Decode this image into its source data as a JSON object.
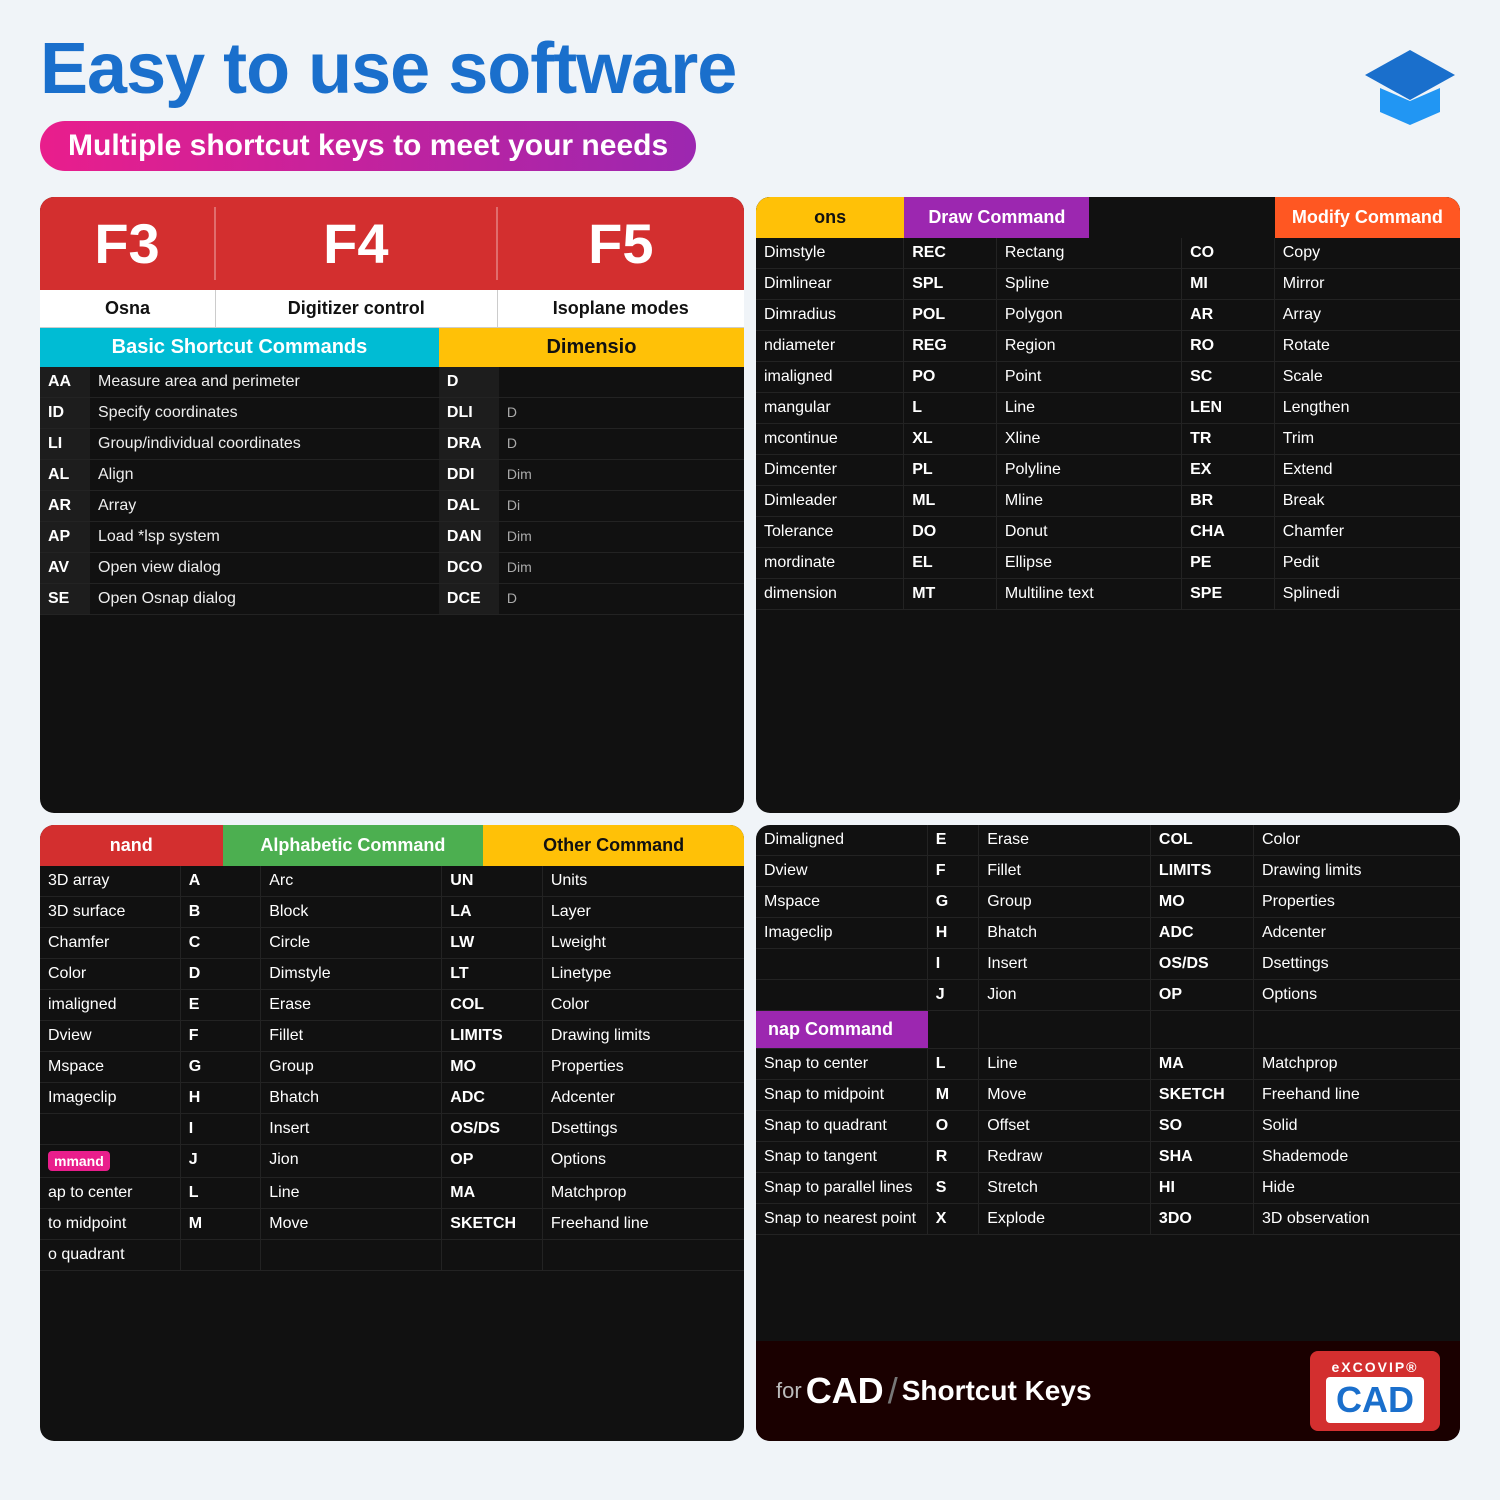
{
  "header": {
    "title": "Easy to use software",
    "subtitle": "Multiple shortcut keys to meet your needs"
  },
  "card1": {
    "fkeys": [
      {
        "key": "F3",
        "desc": "Osna"
      },
      {
        "key": "F4",
        "desc": "Digitizer control"
      },
      {
        "key": "F5",
        "desc": "Isoplane modes"
      }
    ],
    "basic_header": "Basic Shortcut Commands",
    "dim_header": "Dimensio",
    "basic_commands": [
      {
        "key": "AA",
        "desc": "Measure area and perimeter"
      },
      {
        "key": "ID",
        "desc": "Specify coordinates"
      },
      {
        "key": "LI",
        "desc": "Group/individual coordinates"
      },
      {
        "key": "AL",
        "desc": "Align"
      },
      {
        "key": "AR",
        "desc": "Array"
      },
      {
        "key": "AP",
        "desc": "Load *lsp system"
      },
      {
        "key": "AV",
        "desc": "Open view dialog"
      },
      {
        "key": "SE",
        "desc": "Open Osnap dialog"
      }
    ],
    "dim_commands": [
      {
        "key": "D",
        "desc": ""
      },
      {
        "key": "DLI",
        "desc": "D"
      },
      {
        "key": "DRA",
        "desc": "D"
      },
      {
        "key": "DDI",
        "desc": "Dim"
      },
      {
        "key": "DAL",
        "desc": "Di"
      },
      {
        "key": "DAN",
        "desc": "Dim"
      },
      {
        "key": "DCO",
        "desc": "Dim"
      },
      {
        "key": "DCE",
        "desc": "D"
      }
    ]
  },
  "card2": {
    "col_headers": [
      "ons",
      "Draw Command",
      "",
      "Modify Command"
    ],
    "rows": [
      {
        "c1": "Dimstyle",
        "c2": "REC",
        "c3": "Rectang",
        "c4": "CO",
        "c5": "Copy"
      },
      {
        "c1": "Dimlinear",
        "c2": "SPL",
        "c3": "Spline",
        "c4": "MI",
        "c5": "Mirror"
      },
      {
        "c1": "Dimradius",
        "c2": "POL",
        "c3": "Polygon",
        "c4": "AR",
        "c5": "Array"
      },
      {
        "c1": "ndiameter",
        "c2": "REG",
        "c3": "Region",
        "c4": "RO",
        "c5": "Rotate"
      },
      {
        "c1": "imaligned",
        "c2": "PO",
        "c3": "Point",
        "c4": "SC",
        "c5": "Scale"
      },
      {
        "c1": "mangular",
        "c2": "L",
        "c3": "Line",
        "c4": "LEN",
        "c5": "Lengthen"
      },
      {
        "c1": "mcontinue",
        "c2": "XL",
        "c3": "Xline",
        "c4": "TR",
        "c5": "Trim"
      },
      {
        "c1": "Dimcenter",
        "c2": "PL",
        "c3": "Polyline",
        "c4": "EX",
        "c5": "Extend"
      },
      {
        "c1": "Dimleader",
        "c2": "ML",
        "c3": "Mline",
        "c4": "BR",
        "c5": "Break"
      },
      {
        "c1": "Tolerance",
        "c2": "DO",
        "c3": "Donut",
        "c4": "CHA",
        "c5": "Chamfer"
      },
      {
        "c1": "mordinate",
        "c2": "EL",
        "c3": "Ellipse",
        "c4": "PE",
        "c5": "Pedit"
      },
      {
        "c1": "dimension",
        "c2": "MT",
        "c3": "Multiline text",
        "c4": "SPE",
        "c5": "Splinedi"
      }
    ]
  },
  "card3": {
    "col_headers": [
      "nand",
      "Alphabetic Command",
      "Other Command"
    ],
    "rows": [
      {
        "c1": "3D array",
        "c2": "A",
        "c3": "Arc",
        "c4": "UN",
        "c5": "Units"
      },
      {
        "c1": "3D surface",
        "c2": "B",
        "c3": "Block",
        "c4": "LA",
        "c5": "Layer"
      },
      {
        "c1": "Chamfer",
        "c2": "C",
        "c3": "Circle",
        "c4": "LW",
        "c5": "Lweight"
      },
      {
        "c1": "Color",
        "c2": "D",
        "c3": "Dimstyle",
        "c4": "LT",
        "c5": "Linetype"
      },
      {
        "c1": "imaligned",
        "c2": "E",
        "c3": "Erase",
        "c4": "COL",
        "c5": "Color"
      },
      {
        "c1": "Dview",
        "c2": "F",
        "c3": "Fillet",
        "c4": "LIMITS",
        "c5": "Drawing limits"
      },
      {
        "c1": "Mspace",
        "c2": "G",
        "c3": "Group",
        "c4": "MO",
        "c5": "Properties"
      },
      {
        "c1": "Imageclip",
        "c2": "H",
        "c3": "Bhatch",
        "c4": "ADC",
        "c5": "Adcenter"
      },
      {
        "c1": "",
        "c2": "I",
        "c3": "Insert",
        "c4": "OS/DS",
        "c5": "Dsettings"
      },
      {
        "c1": "mmand",
        "c2": "J",
        "c3": "Jion",
        "c4": "OP",
        "c5": "Options"
      },
      {
        "c1": "ap to center",
        "c2": "L",
        "c3": "Line",
        "c4": "MA",
        "c5": "Matchprop"
      },
      {
        "c1": "to midpoint",
        "c2": "M",
        "c3": "Move",
        "c4": "SKETCH",
        "c5": "Freehand line"
      },
      {
        "c1": "o quadrant",
        "c2": "",
        "c3": "",
        "c4": "",
        "c5": ""
      }
    ]
  },
  "card4": {
    "rows_top": [
      {
        "c1": "Dimaligned",
        "c2": "E",
        "c3": "Erase",
        "c4": "COL",
        "c5": "Color"
      },
      {
        "c1": "Dview",
        "c2": "F",
        "c3": "Fillet",
        "c4": "LIMITS",
        "c5": "Drawing limits"
      },
      {
        "c1": "Mspace",
        "c2": "G",
        "c3": "Group",
        "c4": "MO",
        "c5": "Properties"
      },
      {
        "c1": "Imageclip",
        "c2": "H",
        "c3": "Bhatch",
        "c4": "ADC",
        "c5": "Adcenter"
      },
      {
        "c1": "",
        "c2": "I",
        "c3": "Insert",
        "c4": "OS/DS",
        "c5": "Dsettings"
      },
      {
        "c1": "",
        "c2": "J",
        "c3": "Jion",
        "c4": "OP",
        "c5": "Options"
      }
    ],
    "snap_header": "nap Command",
    "snap_rows": [
      {
        "snap": "Snap to center",
        "c2": "L",
        "c3": "Line",
        "c4": "MA",
        "c5": "Matchprop"
      },
      {
        "snap": "Snap to midpoint",
        "c2": "M",
        "c3": "Move",
        "c4": "SKETCH",
        "c5": "Freehand line"
      },
      {
        "snap": "Snap to quadrant",
        "c2": "O",
        "c3": "Offset",
        "c4": "SO",
        "c5": "Solid"
      },
      {
        "snap": "Snap to tangent",
        "c2": "R",
        "c3": "Redraw",
        "c4": "SHA",
        "c5": "Shademode"
      },
      {
        "snap": "Snap to parallel lines",
        "c2": "S",
        "c3": "Stretch",
        "c4": "HI",
        "c5": "Hide"
      },
      {
        "snap": "Snap to nearest point",
        "c2": "X",
        "c3": "Explode",
        "c4": "3DO",
        "c5": "3D observation"
      }
    ],
    "footer": {
      "for_text": "for",
      "cad_text": "CAD",
      "slash": "/",
      "shortcut_text": "Shortcut Keys",
      "brand_top": "eXCOVIP",
      "brand_cad": "CAD"
    }
  }
}
